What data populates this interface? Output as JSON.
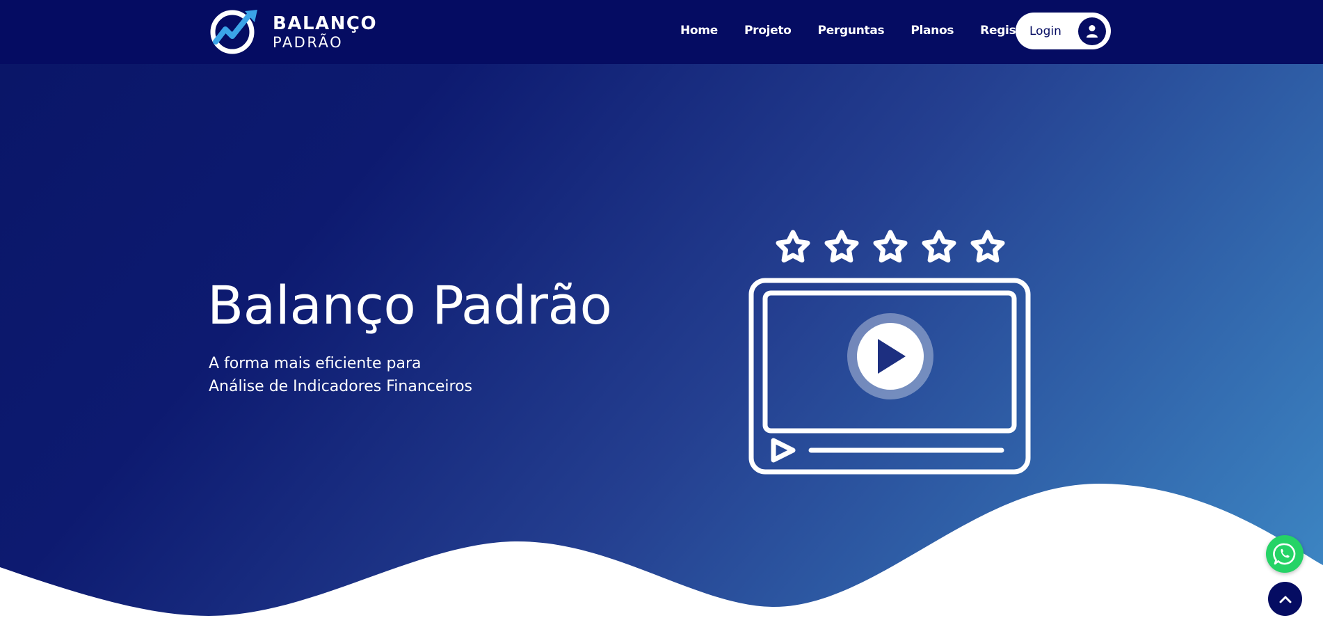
{
  "brand": {
    "line1": "BALANÇO",
    "line2": "PADRÃO",
    "logo_icon": "chart-up-circle-icon"
  },
  "nav": {
    "links": [
      {
        "label": "Home"
      },
      {
        "label": "Projeto"
      },
      {
        "label": "Perguntas"
      },
      {
        "label": "Planos"
      },
      {
        "label": "Registro"
      }
    ],
    "login_label": "Login",
    "login_icon": "user-icon"
  },
  "hero": {
    "title": "Balanço Padrão",
    "subtitle_line1": "A forma mais eficiente para",
    "subtitle_line2": "Análise de Indicadores Financeiros",
    "illustration_icon": "video-player-five-star-icon",
    "rating_stars": 5
  },
  "floating": {
    "whatsapp_icon": "whatsapp-icon",
    "back_to_top_icon": "chevron-up-icon"
  },
  "colors": {
    "navbar": "#050c62",
    "hero_gradient_start": "#0a1668",
    "hero_gradient_end": "#3e8ac6",
    "logo_accent": "#3ba4e8",
    "whatsapp": "#25d366"
  }
}
